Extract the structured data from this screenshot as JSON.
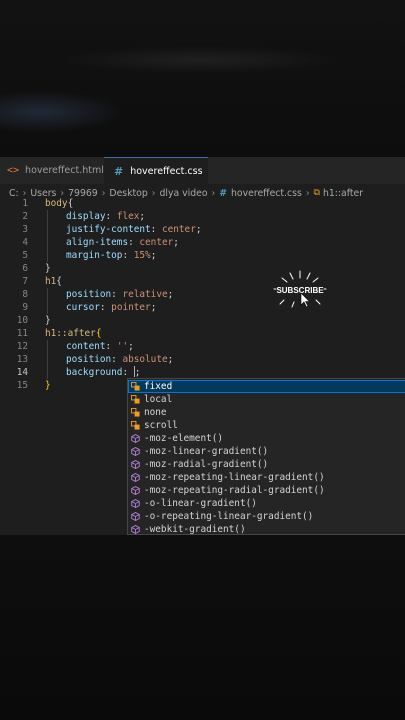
{
  "tabs": [
    {
      "label": "hovereffect.html",
      "active": false
    },
    {
      "label": "hovereffect.css",
      "active": true,
      "unsaved": true
    }
  ],
  "breadcrumb": [
    "C:",
    "Users",
    "79969",
    "Desktop",
    "dlya video",
    "hovereffect.css",
    "h1::after"
  ],
  "colors": {
    "selector": "#d7ba7d",
    "property": "#9cdcfe",
    "value": "#ce9178",
    "punctuation": "#d4d4d4",
    "line_number": "#858585",
    "suggest_selected_bg": "#04395e",
    "enum_icon": "#ee9d28",
    "method_icon": "#b180d7"
  },
  "code_lines": [
    {
      "n": "1",
      "indent": 0,
      "parts": [
        [
          "sel",
          "body"
        ],
        [
          "pun",
          "{"
        ]
      ]
    },
    {
      "n": "2",
      "indent": 1,
      "parts": [
        [
          "prop",
          "display"
        ],
        [
          "pun",
          ": "
        ],
        [
          "val",
          "flex"
        ],
        [
          "pun",
          ";"
        ]
      ]
    },
    {
      "n": "3",
      "indent": 1,
      "parts": [
        [
          "prop",
          "justify-content"
        ],
        [
          "pun",
          ": "
        ],
        [
          "val",
          "center"
        ],
        [
          "pun",
          ";"
        ]
      ]
    },
    {
      "n": "4",
      "indent": 1,
      "parts": [
        [
          "prop",
          "align-items"
        ],
        [
          "pun",
          ": "
        ],
        [
          "val",
          "center"
        ],
        [
          "pun",
          ";"
        ]
      ]
    },
    {
      "n": "5",
      "indent": 1,
      "parts": [
        [
          "prop",
          "margin-top"
        ],
        [
          "pun",
          ": "
        ],
        [
          "val",
          "15%"
        ],
        [
          "pun",
          ";"
        ]
      ]
    },
    {
      "n": "6",
      "indent": 0,
      "parts": [
        [
          "pun",
          "}"
        ]
      ]
    },
    {
      "n": "7",
      "indent": 0,
      "parts": [
        [
          "sel",
          "h1"
        ],
        [
          "pun",
          "{"
        ]
      ]
    },
    {
      "n": "8",
      "indent": 1,
      "parts": [
        [
          "prop",
          "position"
        ],
        [
          "pun",
          ": "
        ],
        [
          "val",
          "relative"
        ],
        [
          "pun",
          ";"
        ]
      ]
    },
    {
      "n": "9",
      "indent": 1,
      "parts": [
        [
          "prop",
          "cursor"
        ],
        [
          "pun",
          ": "
        ],
        [
          "val",
          "pointer"
        ],
        [
          "pun",
          ";"
        ]
      ]
    },
    {
      "n": "10",
      "indent": 0,
      "parts": [
        [
          "pun",
          "}"
        ]
      ]
    },
    {
      "n": "11",
      "indent": 0,
      "parts": [
        [
          "sel",
          "h1::after"
        ],
        [
          "brk",
          "{"
        ]
      ]
    },
    {
      "n": "12",
      "indent": 1,
      "parts": [
        [
          "prop",
          "content"
        ],
        [
          "pun",
          ": "
        ],
        [
          "val",
          "''"
        ],
        [
          "pun",
          ";"
        ]
      ]
    },
    {
      "n": "13",
      "indent": 1,
      "parts": [
        [
          "prop",
          "position"
        ],
        [
          "pun",
          ": "
        ],
        [
          "val",
          "absolute"
        ],
        [
          "pun",
          ";"
        ]
      ]
    },
    {
      "n": "14",
      "indent": 1,
      "current": true,
      "parts": [
        [
          "prop",
          "background"
        ],
        [
          "pun",
          ": "
        ],
        [
          "cursor",
          ""
        ],
        [
          "pun",
          ";"
        ]
      ]
    },
    {
      "n": "15",
      "indent": 0,
      "parts": [
        [
          "brk",
          "}"
        ]
      ]
    }
  ],
  "suggestions": [
    {
      "label": "fixed",
      "kind": "enum",
      "selected": true
    },
    {
      "label": "local",
      "kind": "enum"
    },
    {
      "label": "none",
      "kind": "enum"
    },
    {
      "label": "scroll",
      "kind": "enum"
    },
    {
      "label": "-moz-element()",
      "kind": "method"
    },
    {
      "label": "-moz-linear-gradient()",
      "kind": "method"
    },
    {
      "label": "-moz-radial-gradient()",
      "kind": "method"
    },
    {
      "label": "-moz-repeating-linear-gradient()",
      "kind": "method"
    },
    {
      "label": "-moz-repeating-radial-gradient()",
      "kind": "method"
    },
    {
      "label": "-o-linear-gradient()",
      "kind": "method"
    },
    {
      "label": "-o-repeating-linear-gradient()",
      "kind": "method"
    },
    {
      "label": "-webkit-gradient()",
      "kind": "method"
    }
  ],
  "overlay": {
    "subscribe_text": "SUBSCRIBE"
  }
}
